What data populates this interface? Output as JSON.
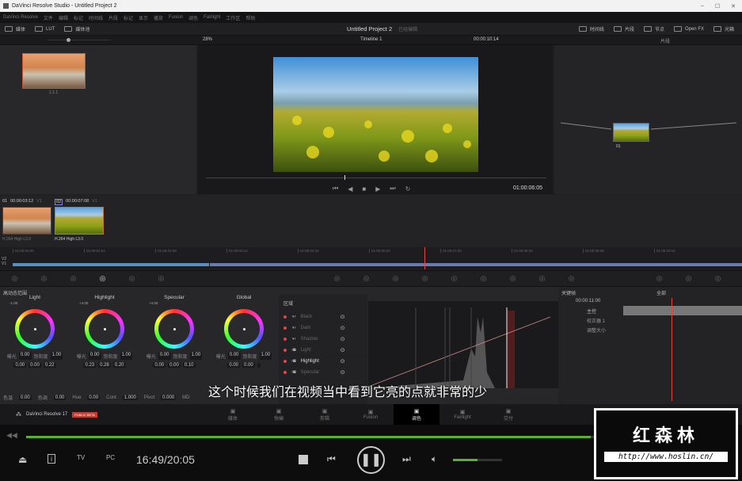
{
  "window": {
    "title": "DaVinci Resolve Studio - Untitled Project 2",
    "min": "–",
    "max": "☐",
    "close": "✕"
  },
  "menu": [
    "DaVinci Resolve",
    "文件",
    "编辑",
    "标记",
    "时间线",
    "片段",
    "标记",
    "显示",
    "播放",
    "Fusion",
    "调色",
    "Fairlight",
    "工作区",
    "帮助"
  ],
  "toolbar": {
    "left": [
      "媒体",
      "LUT",
      "媒体池"
    ],
    "project": "Untitled Project 2",
    "status": "已经编辑",
    "right": [
      "时间线",
      "片段",
      "节点",
      "Open FX",
      "光箱"
    ]
  },
  "toolbar2": {
    "zoom": "28%",
    "timeline": "Timeline 1",
    "timecode": "00:00:10:14",
    "node_mode": "片段"
  },
  "mediapool": {
    "clip_label": "1.1.1"
  },
  "viewer": {
    "timecode": "01:00:06:05"
  },
  "nodes": {
    "node_label": "01"
  },
  "clips": [
    {
      "index": "01",
      "tc": "00:00:03:12",
      "track": "V1",
      "codec": "H.264 High L3.0"
    },
    {
      "index": "02",
      "tc": "00:00:07:08",
      "track": "V1",
      "codec": "H.264 High L3.0"
    }
  ],
  "ruler": [
    "01:00:00:00",
    "01:00:01:04",
    "01:00:02:08",
    "01:00:03:12",
    "01:00:04:16",
    "01:00:05:20",
    "01:00:07:00",
    "01:00:08:04",
    "01:00:09:08",
    "01:00:10:12"
  ],
  "tracks": [
    "V2",
    "V1"
  ],
  "color": {
    "panel_title": "高动态范围",
    "wheels": [
      {
        "name": "Light",
        "offset": "-1.00",
        "exp": "0.00",
        "sat": "1.00",
        "x": "0.00",
        "y": "0.00",
        "z": "0.22"
      },
      {
        "name": "Highlight",
        "offset": "+4.00",
        "exp": "0.00",
        "sat": "1.00",
        "x": "0.23",
        "y": "0.26",
        "z": "0.20"
      },
      {
        "name": "Specular",
        "offset": "+4.00",
        "exp": "0.00",
        "sat": "1.00",
        "x": "0.00",
        "y": "0.00",
        "z": "0.10"
      },
      {
        "name": "Global",
        "offset": "",
        "exp": "0.00",
        "sat": "1.00",
        "x": "0.00",
        "y": "0.00",
        "z": ""
      }
    ],
    "exp_label": "曝光",
    "sat_label": "饱和度",
    "bottom": [
      {
        "l": "色温",
        "v": "0.00"
      },
      {
        "l": "色调",
        "v": "0.00"
      },
      {
        "l": "Hue",
        "v": "0.00"
      },
      {
        "l": "Cont",
        "v": "1.000"
      },
      {
        "l": "Pivot",
        "v": "0.000"
      },
      {
        "l": "MD",
        "v": ""
      }
    ],
    "zones_title": "区域",
    "zones": [
      "Black",
      "Dark",
      "Shadow",
      "Light",
      "Highlight",
      "Specular"
    ],
    "keyframes_title": "关键帧",
    "kf_mode": "全部",
    "kf_tc": "00:00:11:00",
    "kf_master": "主控",
    "kf_items": [
      "校正器 1",
      "调整大小"
    ]
  },
  "subtitle": "这个时候我们在视频当中看到它亮的点就非常的少",
  "pagebar": {
    "app": "DaVinci Resolve 17",
    "badge": "PUBLIC BETA",
    "pages": [
      "媒体",
      "快编",
      "剪辑",
      "Fusion",
      "调色",
      "Fairlight",
      "交付"
    ],
    "active": 4
  },
  "player": {
    "time": "16:49/20:05",
    "progress": 0.82,
    "volume": 0.5
  },
  "watermark": {
    "name": "红森林",
    "url": "http://www.hoslin.cn/"
  },
  "colors": {
    "accent": "#e04848",
    "progress": "#5bb030"
  }
}
